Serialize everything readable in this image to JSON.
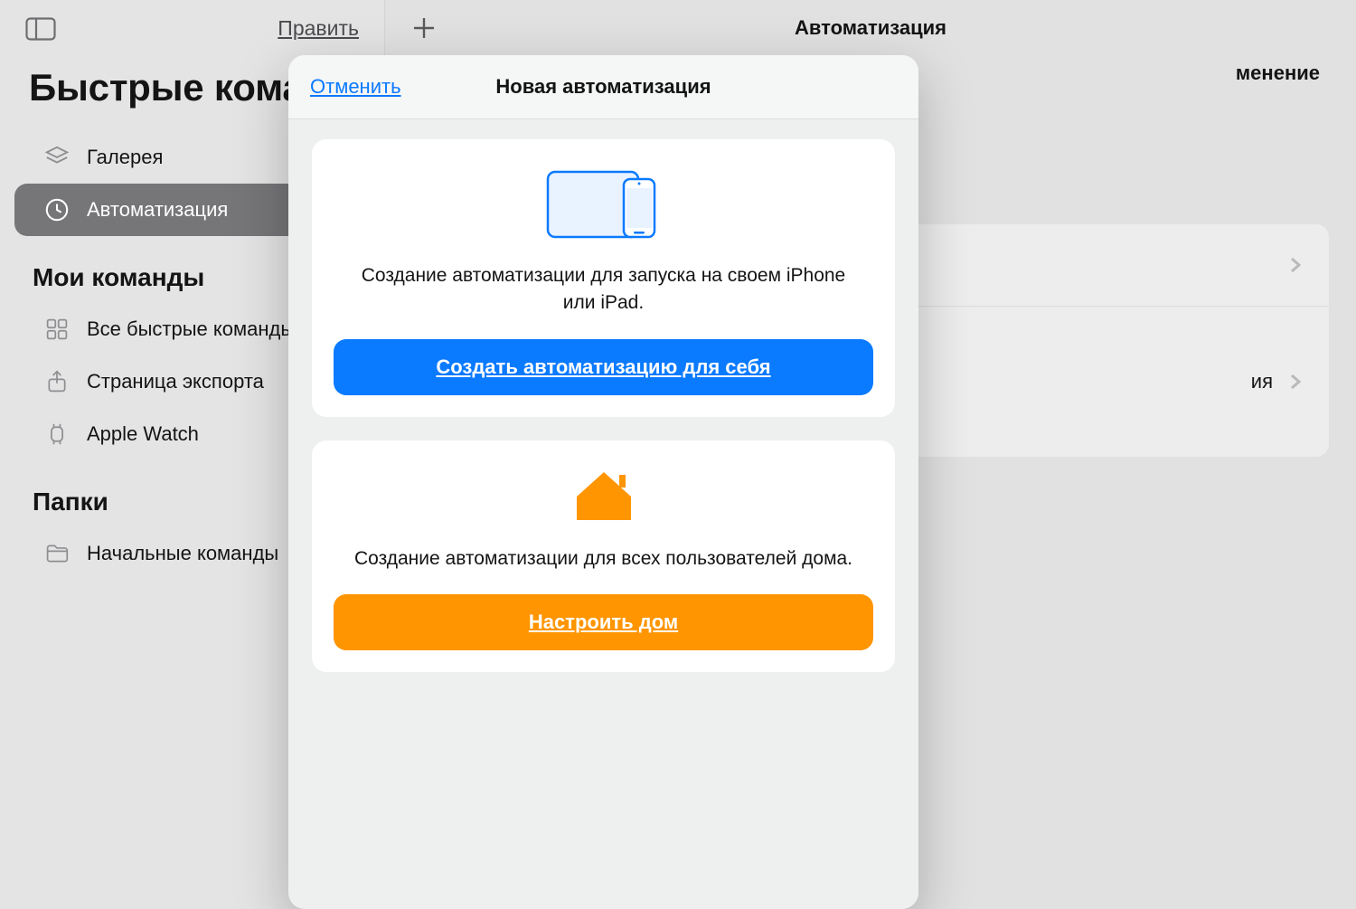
{
  "sidebar": {
    "edit": "Править",
    "title": "Быстрые команды",
    "items": [
      {
        "label": "Галерея"
      },
      {
        "label": "Автоматизация"
      }
    ],
    "section_commands": "Мои команды",
    "commands": [
      {
        "label": "Все быстрые команды"
      },
      {
        "label": "Страница экспорта"
      },
      {
        "label": "Apple Watch"
      }
    ],
    "section_folders": "Папки",
    "folders": [
      {
        "label": "Начальные команды"
      }
    ]
  },
  "main": {
    "title": "Автоматизация",
    "subheader_right": "менение",
    "rows": [
      {
        "tail": ""
      },
      {
        "tail": "ия"
      }
    ]
  },
  "modal": {
    "cancel": "Отменить",
    "title": "Новая автоматизация",
    "personal": {
      "desc": "Создание автоматизации для запуска на своем iPhone или iPad.",
      "button": "Создать автоматизацию для себя"
    },
    "home": {
      "desc": "Создание автоматизации для всех пользователей дома.",
      "button": "Настроить дом"
    }
  }
}
